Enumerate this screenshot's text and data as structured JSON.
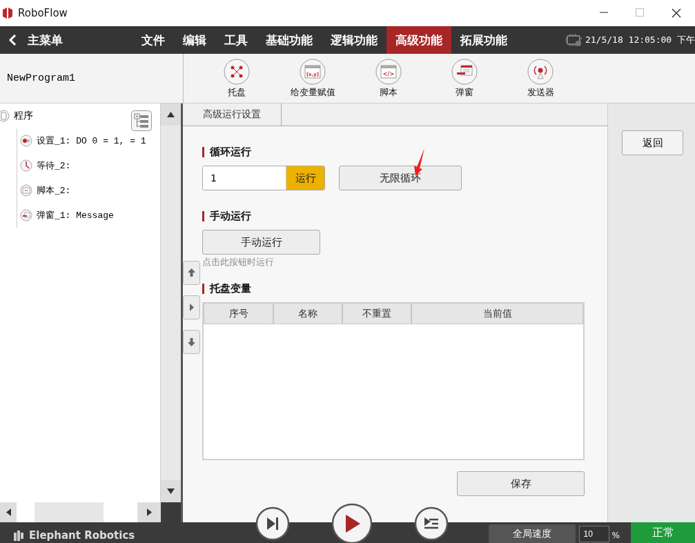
{
  "window": {
    "title": "RoboFlow"
  },
  "menu": {
    "back_label": "主菜单",
    "datetime": "21/5/18 12:05:00 下午",
    "items": [
      {
        "label": "文件",
        "selected": false
      },
      {
        "label": "编辑",
        "selected": false
      },
      {
        "label": "工具",
        "selected": false
      },
      {
        "label": "基础功能",
        "selected": false
      },
      {
        "label": "逻辑功能",
        "selected": false
      },
      {
        "label": "高级功能",
        "selected": true
      },
      {
        "label": "拓展功能",
        "selected": false
      }
    ]
  },
  "program_name": "NewProgram1",
  "toolbar": [
    {
      "label": "托盘",
      "kind": "pallet"
    },
    {
      "label": "给变量赋值",
      "kind": "assign",
      "icon_text": "[x,y]"
    },
    {
      "label": "脚本",
      "kind": "script",
      "icon_text": "</>"
    },
    {
      "label": "弹窗",
      "kind": "popup"
    },
    {
      "label": "发送器",
      "kind": "sender"
    }
  ],
  "tree": {
    "label": "程序",
    "children": [
      {
        "label": "设置_1: DO 0 = 1,  = 1",
        "kind": "set"
      },
      {
        "label": "等待_2:",
        "kind": "wait"
      },
      {
        "label": "脚本_2:",
        "kind": "script"
      },
      {
        "label": "弹窗_1: Message",
        "kind": "popup"
      }
    ]
  },
  "tabs": [
    {
      "label": "高级运行设置",
      "selected": true
    }
  ],
  "loop": {
    "title": "循环运行",
    "count": "1",
    "run_button": "运行",
    "infinite_button": "无限循环"
  },
  "manual": {
    "title": "手动运行",
    "button": "手动运行",
    "hint": "点击此按钮时运行"
  },
  "pallet_vars": {
    "title": "托盘变量",
    "columns": [
      "序号",
      "名称",
      "不重置",
      "当前值"
    ]
  },
  "save_button": "保存",
  "back_button": "返回",
  "footer": {
    "brand": "Elephant Robotics",
    "speed_button": "全局速度",
    "speed_value": "10",
    "unit": "%",
    "status": "正常"
  }
}
